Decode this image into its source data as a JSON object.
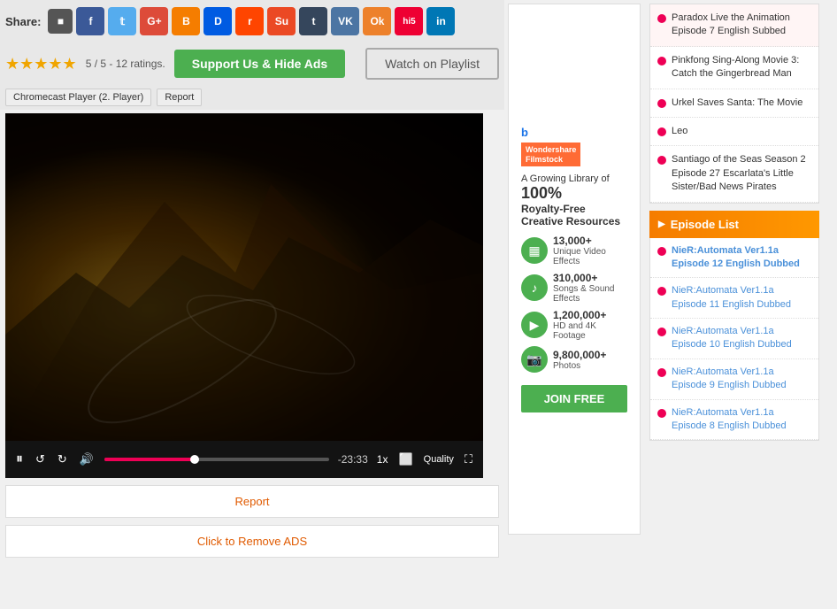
{
  "share": {
    "label": "Share:",
    "icons": [
      {
        "name": "delicious",
        "symbol": "d",
        "class": "si-delicious"
      },
      {
        "name": "facebook",
        "symbol": "f",
        "class": "si-facebook"
      },
      {
        "name": "twitter",
        "symbol": "t",
        "class": "si-twitter"
      },
      {
        "name": "google",
        "symbol": "G+",
        "class": "si-google"
      },
      {
        "name": "blogger",
        "symbol": "B",
        "class": "si-blogger"
      },
      {
        "name": "digg",
        "symbol": "D",
        "class": "si-digg"
      },
      {
        "name": "reddit",
        "symbol": "r",
        "class": "si-reddit"
      },
      {
        "name": "stumbleupon",
        "symbol": "Su",
        "class": "si-stumble"
      },
      {
        "name": "tumblr",
        "symbol": "t",
        "class": "si-tumblr"
      },
      {
        "name": "vk",
        "symbol": "VK",
        "class": "si-vk"
      },
      {
        "name": "odnoklassniki",
        "symbol": "Ok",
        "class": "si-odnoklassniki"
      },
      {
        "name": "hi5",
        "symbol": "hi5",
        "class": "si-hi5"
      },
      {
        "name": "linkedin",
        "symbol": "in",
        "class": "si-linkedin"
      }
    ]
  },
  "rating": {
    "stars": "★★★★★",
    "text": "5 / 5 - 12 ratings."
  },
  "buttons": {
    "support": "Support Us & Hide Ads",
    "playlist": "Watch on Playlist",
    "chromecast": "Chromecast Player (2. Player)",
    "report_label": "Report",
    "report_bar": "Report",
    "remove_ads": "Click to Remove ADS"
  },
  "player": {
    "time": "-23:33",
    "speed": "1x",
    "quality": "Quality"
  },
  "ad": {
    "logo": "Wondershare\nFilmstock",
    "tagline": "A Growing Library of",
    "percent": "100%",
    "subtitle": "Royalty-Free\nCreative Resources",
    "features": [
      {
        "icon": "▦",
        "count": "13,000+",
        "label": "Unique Video Effects",
        "color": "#4CAF50"
      },
      {
        "icon": "♪",
        "count": "310,000+",
        "label": "Songs & Sound Effects",
        "color": "#4CAF50"
      },
      {
        "icon": "▶",
        "count": "1,200,000+",
        "label": "HD and 4K Footage",
        "color": "#4CAF50"
      },
      {
        "icon": "⬛",
        "count": "9,800,000+",
        "label": "Photos",
        "color": "#4CAF50"
      }
    ],
    "join_btn": "JOIN FREE"
  },
  "sidebar": {
    "items": [
      {
        "text": "Paradox Live the Animation Episode 7 English Subbed",
        "is_paradox": true
      },
      {
        "text": "Pinkfong Sing-Along Movie 3: Catch the Gingerbread Man",
        "is_paradox": false
      },
      {
        "text": "Urkel Saves Santa: The Movie",
        "is_paradox": false
      },
      {
        "text": "Leo",
        "is_paradox": false
      },
      {
        "text": "Santiago of the Seas Season 2 Episode 27 Escarlata's Little Sister/Bad News Pirates",
        "is_paradox": false
      }
    ],
    "episode_header": "Episode List",
    "episodes": [
      {
        "text": "NieR:Automata Ver1.1a Episode 12 English Dubbed",
        "highlighted": true
      },
      {
        "text": "NieR:Automata Ver1.1a Episode 11 English Dubbed",
        "highlighted": false
      },
      {
        "text": "NieR:Automata Ver1.1a Episode 10 English Dubbed",
        "highlighted": false
      },
      {
        "text": "NieR:Automata Ver1.1a Episode 9 English Dubbed",
        "highlighted": false
      },
      {
        "text": "NieR:Automata Ver1.1a Episode 8 English Dubbed",
        "highlighted": false
      }
    ]
  }
}
